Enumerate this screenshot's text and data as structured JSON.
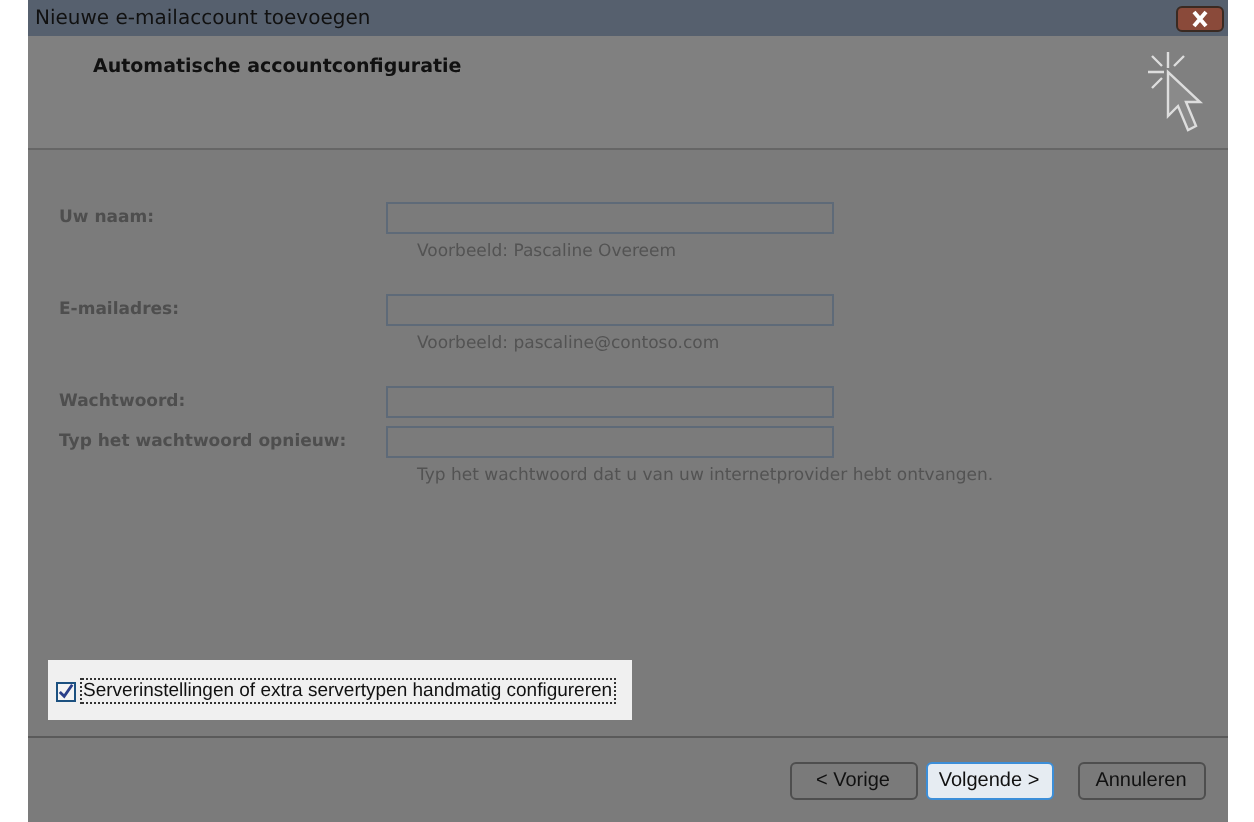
{
  "window": {
    "title": "Nieuwe e-mailaccount toevoegen"
  },
  "header": {
    "title": "Automatische accountconfiguratie"
  },
  "fields": [
    {
      "label": "Uw naam:",
      "hint": "Voorbeeld: Pascaline Overeem"
    },
    {
      "label": "E-mailadres:",
      "hint": "Voorbeeld: pascaline@contoso.com"
    },
    {
      "label": "Wachtwoord:"
    },
    {
      "label": "Typ het wachtwoord opnieuw:",
      "hint": "Typ het wachtwoord dat u van uw internetprovider hebt ontvangen."
    }
  ],
  "manual_option": {
    "label": "Serverinstellingen of extra servertypen handmatig configureren",
    "checked": true
  },
  "buttons": [
    {
      "label": "< Vorige",
      "selected": false
    },
    {
      "label": "Volgende >",
      "selected": true
    },
    {
      "label": "Annuleren",
      "selected": false
    }
  ]
}
